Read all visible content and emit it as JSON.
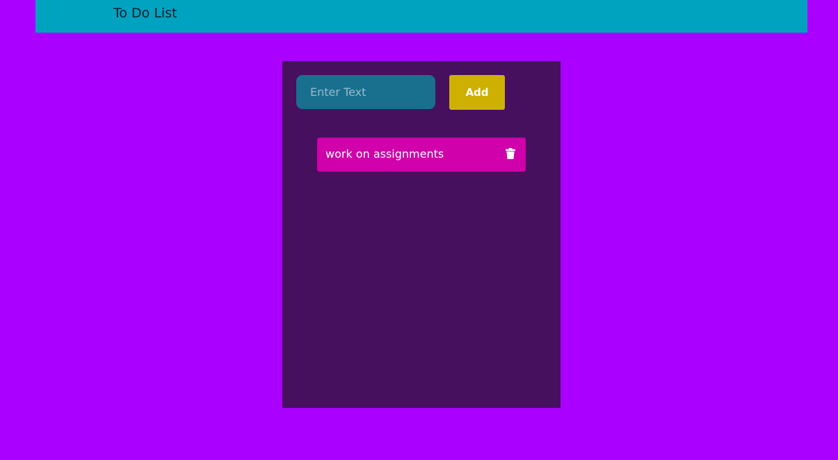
{
  "header": {
    "title": "To Do List"
  },
  "form": {
    "input_placeholder": "Enter Text",
    "input_value": "",
    "add_label": "Add"
  },
  "tasks": [
    {
      "text": "work on assignments",
      "delete_icon": "trash-icon"
    }
  ],
  "colors": {
    "page_background": "#aa00ff",
    "header_background": "#00a3bf",
    "panel_background": "#46105e",
    "input_background": "#19708e",
    "add_button": "#cdb000",
    "task_background": "#d000aa"
  }
}
